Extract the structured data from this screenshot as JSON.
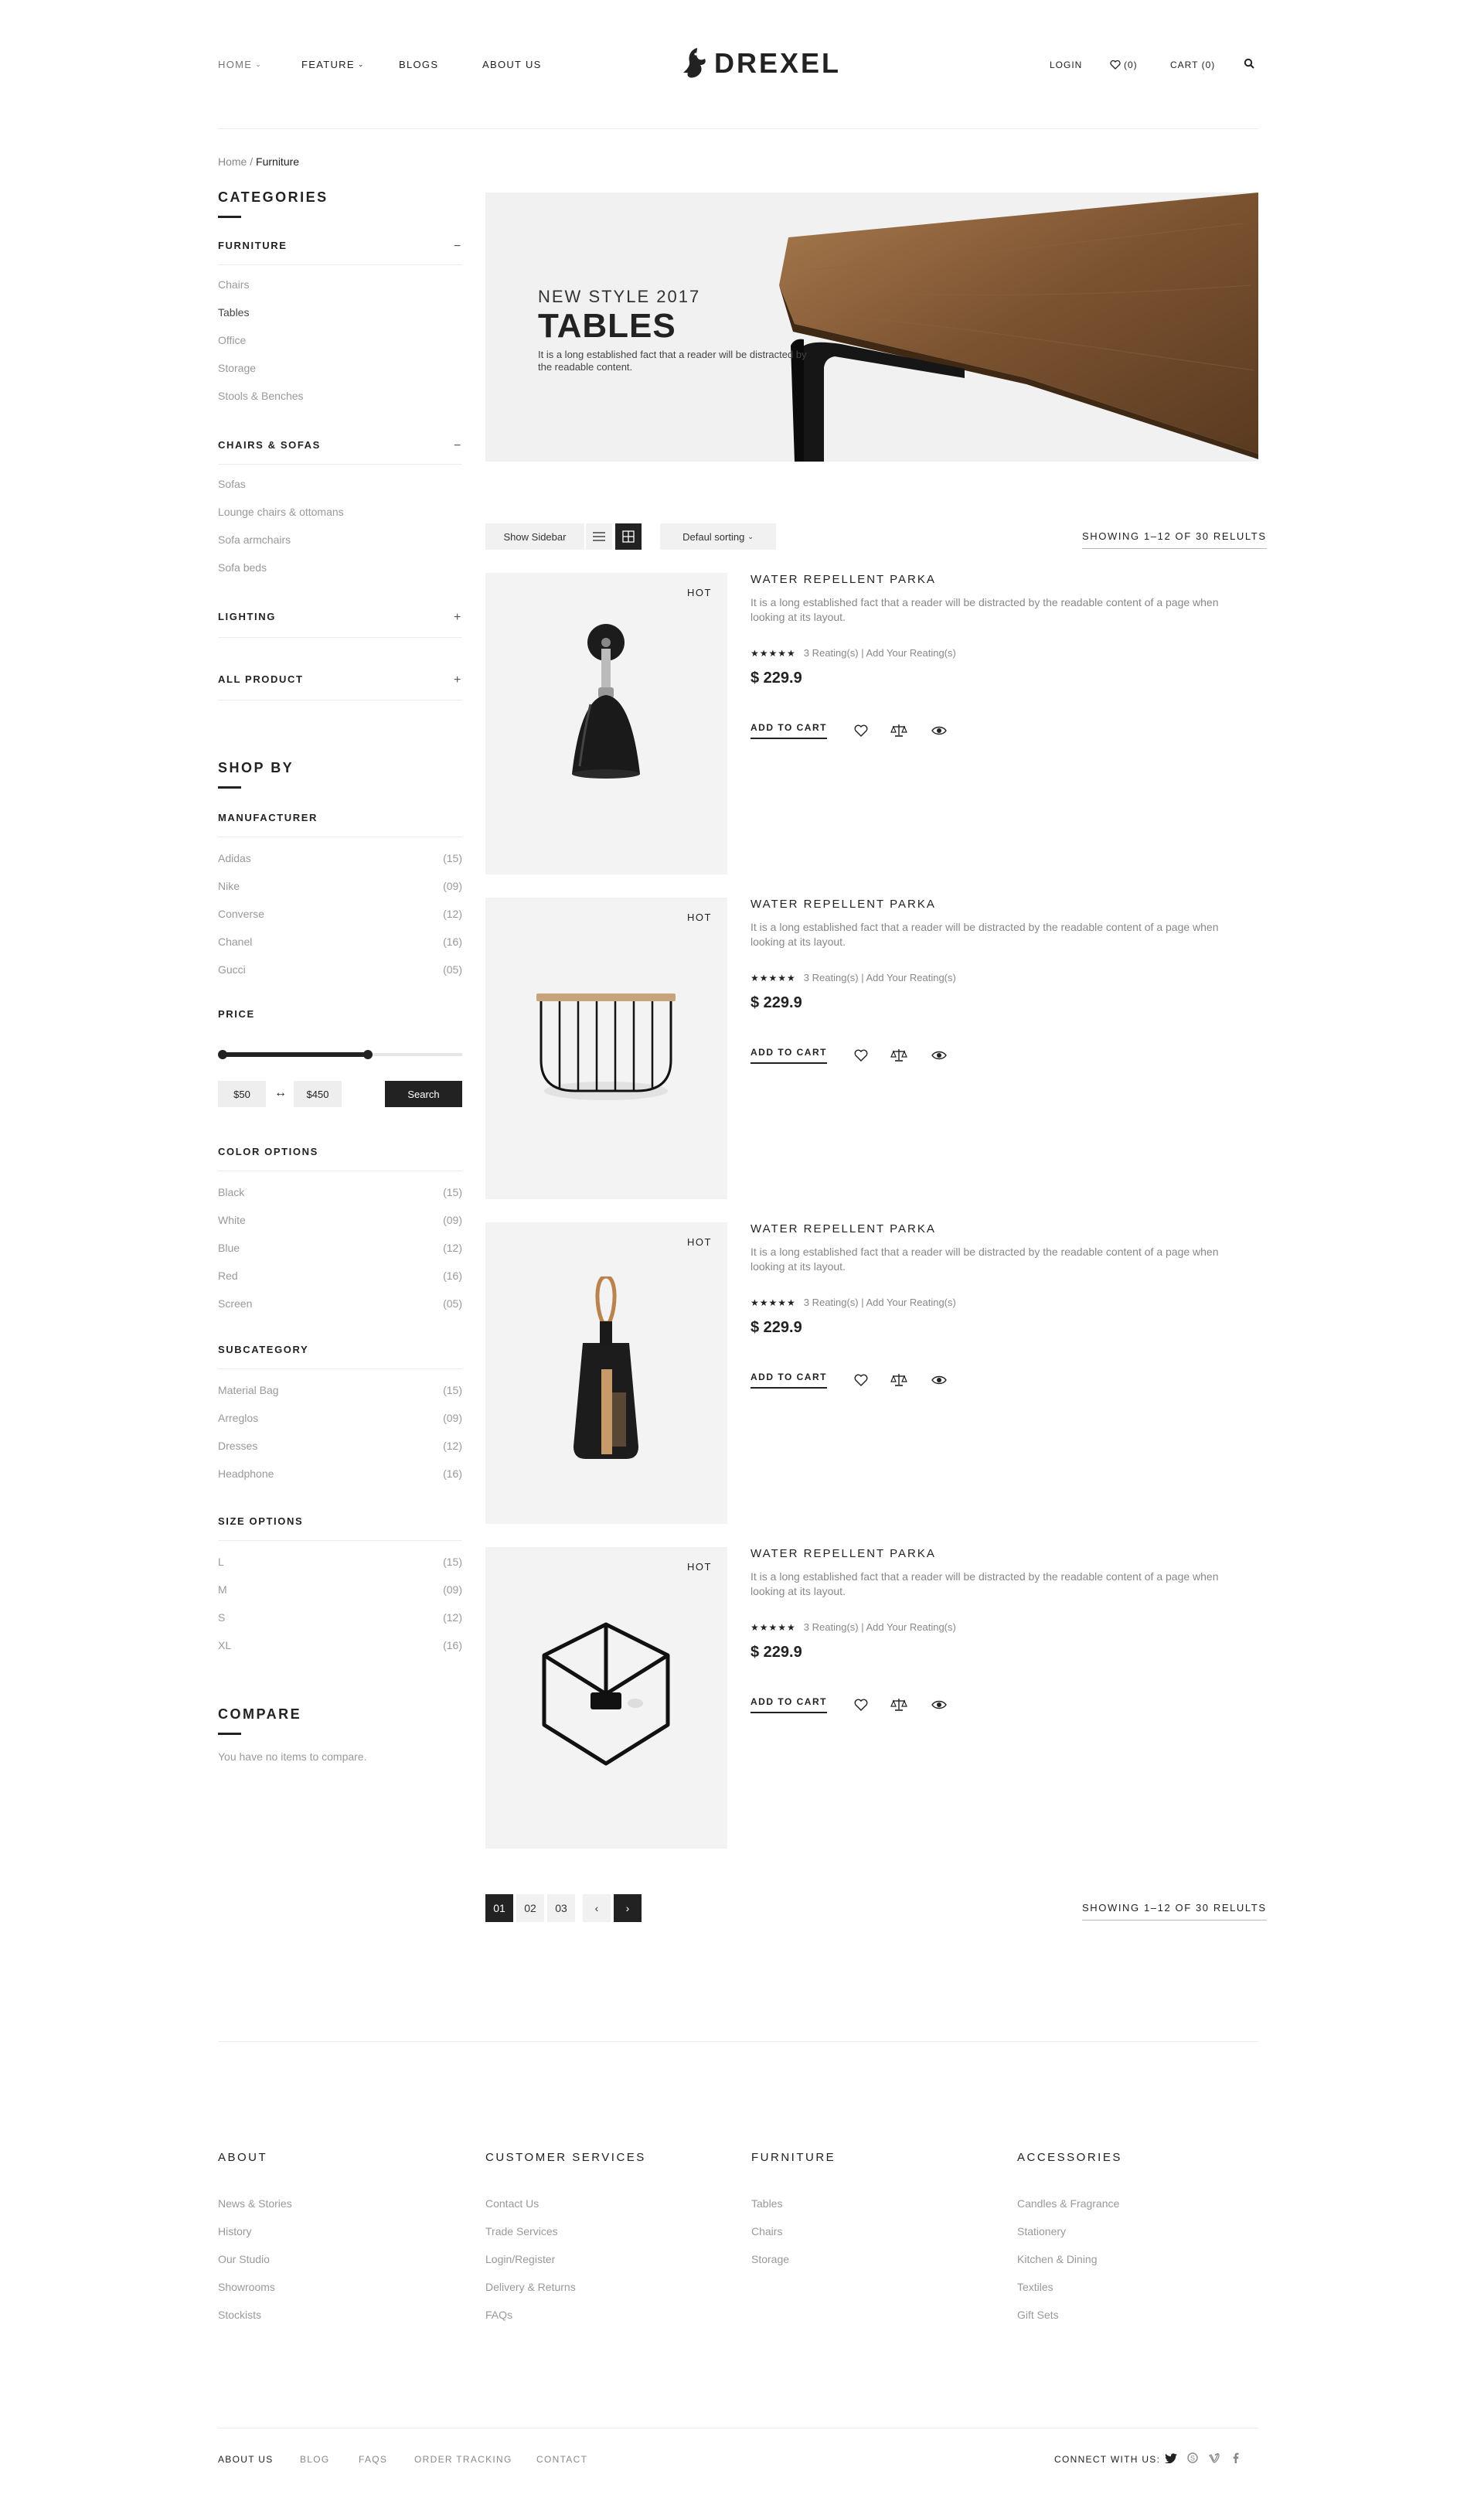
{
  "header": {
    "nav": [
      {
        "label": "HOME",
        "dropdown": true
      },
      {
        "label": "FEATURE",
        "dropdown": true
      },
      {
        "label": "BLOGS",
        "dropdown": false
      },
      {
        "label": "ABOUT US",
        "dropdown": false
      }
    ],
    "brand": "DREXEL",
    "login": "LOGIN",
    "wishlist": "(0)",
    "cart": "CART (0)"
  },
  "breadcrumb": {
    "home": "Home",
    "separator": "/",
    "current": "Furniture"
  },
  "sidebar": {
    "categories_title": "CATEGORIES",
    "groups": [
      {
        "label": "FURNITURE",
        "toggle": "−",
        "items": [
          "Chairs",
          "Tables",
          "Office",
          "Storage",
          "Stools & Benches"
        ]
      },
      {
        "label": "CHAIRS & SOFAS",
        "toggle": "−",
        "items": [
          "Sofas",
          "Lounge chairs & ottomans",
          "Sofa armchairs",
          "Sofa beds"
        ]
      },
      {
        "label": "LIGHTING",
        "toggle": "+"
      },
      {
        "label": "ALL PRODUCT",
        "toggle": "+"
      }
    ],
    "shop_by_title": "SHOP BY",
    "manufacturer": {
      "label": "MANUFACTURER",
      "items": [
        {
          "name": "Adidas",
          "count": "(15)"
        },
        {
          "name": "Nike",
          "count": "(09)"
        },
        {
          "name": "Converse",
          "count": "(12)"
        },
        {
          "name": "Chanel",
          "count": "(16)"
        },
        {
          "name": "Gucci",
          "count": "(05)"
        }
      ]
    },
    "price": {
      "label": "PRICE",
      "min": "$50",
      "max": "$450",
      "range_fill": 0.61,
      "search": "Search"
    },
    "colors": {
      "label": "COLOR OPTIONS",
      "items": [
        {
          "name": "Black",
          "count": "(15)"
        },
        {
          "name": "White",
          "count": "(09)"
        },
        {
          "name": "Blue",
          "count": "(12)"
        },
        {
          "name": "Red",
          "count": "(16)"
        },
        {
          "name": "Screen",
          "count": "(05)"
        }
      ]
    },
    "subcategory": {
      "label": "SUBCATEGORY",
      "items": [
        {
          "name": "Material Bag",
          "count": "(15)"
        },
        {
          "name": "Arreglos",
          "count": "(09)"
        },
        {
          "name": "Dresses",
          "count": "(12)"
        },
        {
          "name": "Headphone",
          "count": "(16)"
        }
      ]
    },
    "sizes": {
      "label": "SIZE OPTIONS",
      "items": [
        {
          "name": "L",
          "count": "(15)"
        },
        {
          "name": "M",
          "count": "(09)"
        },
        {
          "name": "S",
          "count": "(12)"
        },
        {
          "name": "XL",
          "count": "(16)"
        }
      ]
    },
    "compare_title": "COMPARE",
    "compare_text": "You have no items to compare."
  },
  "banner": {
    "kicker": "NEW STYLE 2017",
    "title": "TABLES",
    "desc": "It is a long established fact that a reader will be distracted by the readable content."
  },
  "toolbar": {
    "show_sidebar": "Show Sidebar",
    "sorting": "Defaul sorting",
    "showing": "SHOWING 1–12 OF 30 RELULTS"
  },
  "products": [
    {
      "badge": "HOT",
      "title": "WATER REPELLENT PARKA",
      "desc": "It is a long established fact that a reader will be distracted by the readable content of a page when looking at its layout.",
      "stars": "★★★★★",
      "rating_text": "3 Reating(s) | Add Your Reating(s)",
      "price": "$ 229.9",
      "cart": "ADD TO CART",
      "image": "wall-lamp"
    },
    {
      "badge": "HOT",
      "title": "WATER REPELLENT PARKA",
      "desc": "It is a long established fact that a reader will be distracted by the readable content of a page when looking at its layout.",
      "stars": "★★★★★",
      "rating_text": "3 Reating(s) | Add Your Reating(s)",
      "price": "$ 229.9",
      "cart": "ADD TO CART",
      "image": "wire-shelf"
    },
    {
      "badge": "HOT",
      "title": "WATER REPELLENT PARKA",
      "desc": "It is a long established fact that a reader will be distracted by the readable content of a page when looking at its layout.",
      "stars": "★★★★★",
      "rating_text": "3 Reating(s) | Add Your Reating(s)",
      "price": "$ 229.9",
      "cart": "ADD TO CART",
      "image": "dustpan-brush"
    },
    {
      "badge": "HOT",
      "title": "WATER REPELLENT PARKA",
      "desc": "It is a long established fact that a reader will be distracted by the readable content of a page when looking at its layout.",
      "stars": "★★★★★",
      "rating_text": "3 Reating(s) | Add Your Reating(s)",
      "price": "$ 229.9",
      "cart": "ADD TO CART",
      "image": "cube-candle-holder"
    }
  ],
  "pagination": {
    "pages": [
      "01",
      "02",
      "03"
    ],
    "current": "01",
    "prev": "‹",
    "next": "›",
    "showing": "SHOWING 1–12 OF 30 RELULTS"
  },
  "footer": {
    "columns": [
      {
        "title": "ABOUT",
        "links": [
          "News & Stories",
          "History",
          "Our Studio",
          "Showrooms",
          "Stockists"
        ]
      },
      {
        "title": "CUSTOMER SERVICES",
        "links": [
          "Contact Us",
          "Trade Services",
          "Login/Register",
          "Delivery & Returns",
          "FAQs"
        ]
      },
      {
        "title": "FURNITURE",
        "links": [
          "Tables",
          "Chairs",
          "Storage"
        ]
      },
      {
        "title": "ACCESSORIES",
        "links": [
          "Candles & Fragrance",
          "Stationery",
          "Kitchen & Dining",
          "Textiles",
          "Gift Sets"
        ]
      }
    ],
    "bottom_links": [
      "ABOUT US",
      "BLOG",
      "FAQS",
      "ORDER TRACKING",
      "CONTACT"
    ],
    "connect": "CONNECT WITH US:",
    "social": [
      "twitter-icon",
      "skype-icon",
      "vimeo-icon",
      "facebook-icon"
    ]
  }
}
